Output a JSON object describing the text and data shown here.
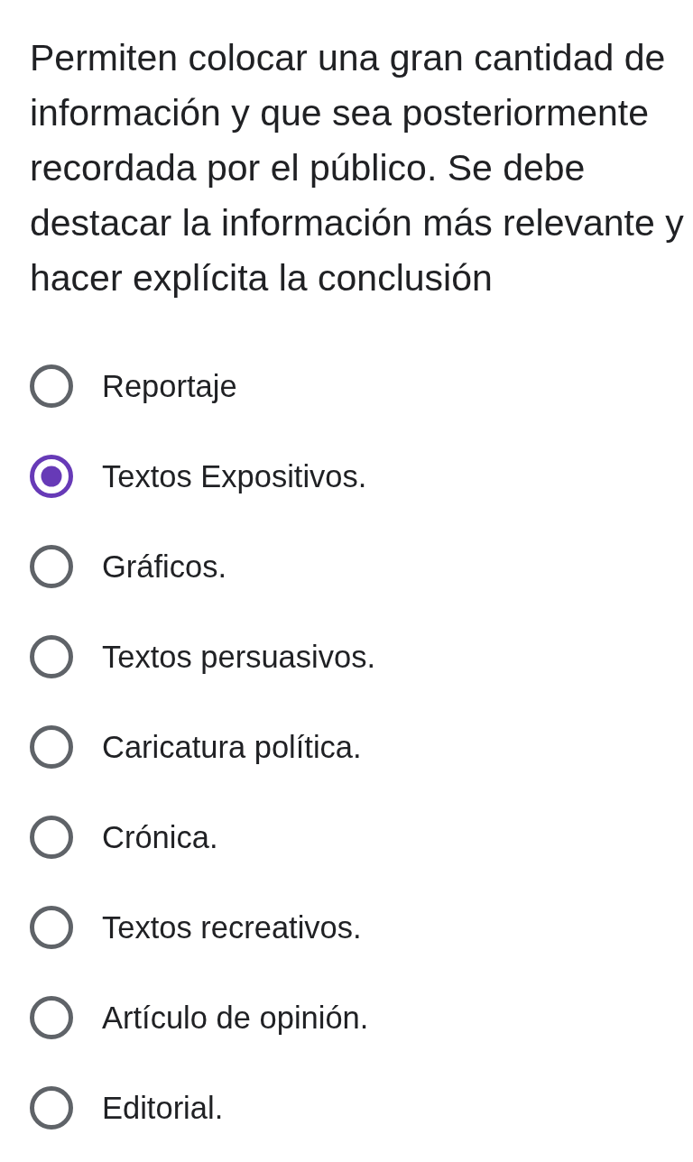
{
  "question": "Permiten colocar una gran cantidad de información y que sea posteriormente recordada por el público. Se debe destacar la información más relevante y hacer explícita la conclusión",
  "options": [
    {
      "label": "Reportaje",
      "selected": false
    },
    {
      "label": "Textos Expositivos.",
      "selected": true
    },
    {
      "label": "Gráficos.",
      "selected": false
    },
    {
      "label": "Textos persuasivos.",
      "selected": false
    },
    {
      "label": "Caricatura política.",
      "selected": false
    },
    {
      "label": "Crónica.",
      "selected": false
    },
    {
      "label": "Textos recreativos.",
      "selected": false
    },
    {
      "label": "Artículo de opinión.",
      "selected": false
    },
    {
      "label": "Editorial.",
      "selected": false
    }
  ]
}
